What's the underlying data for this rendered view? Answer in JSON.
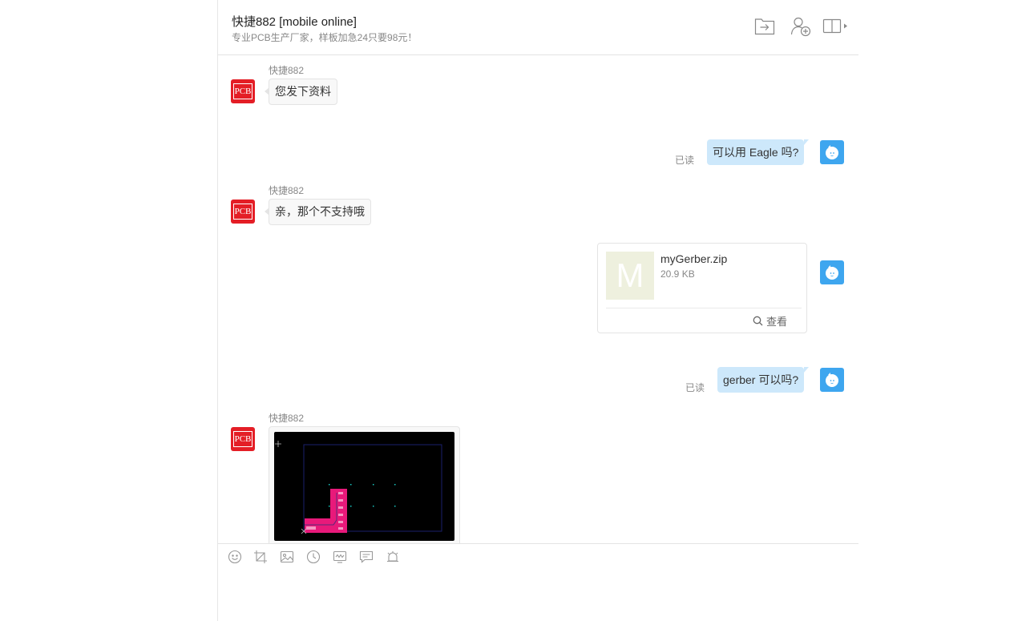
{
  "header": {
    "title": "快捷882 [mobile online]",
    "subtitle": "专业PCB生产厂家，样板加急24只要98元！",
    "icons": [
      "send-file-icon",
      "add-user-icon",
      "sidebar-toggle-icon"
    ]
  },
  "contact": {
    "name": "快捷882",
    "avatar_text": "PCB"
  },
  "messages": [
    {
      "sender": "快捷882",
      "direction": "in",
      "text": "您发下资料"
    },
    {
      "direction": "out",
      "text": "可以用 Eagle 吗?",
      "status": "已读"
    },
    {
      "sender": "快捷882",
      "direction": "in",
      "text": "亲，那个不支持哦"
    },
    {
      "direction": "out",
      "type": "file",
      "thumb_letter": "M",
      "file_name": "myGerber.zip",
      "file_size": "20.9 KB",
      "action": "查看"
    },
    {
      "direction": "out",
      "text": "gerber 可以吗?",
      "status": "已读"
    },
    {
      "sender": "快捷882",
      "direction": "in",
      "type": "image",
      "image_desc": "pcb-gerber-preview"
    }
  ],
  "toolbar": {
    "icons": [
      "emoji-icon",
      "screenshot-crop-icon",
      "image-icon",
      "history-clock-icon",
      "signature-icon",
      "quick-reply-icon",
      "bell-icon"
    ]
  },
  "colors": {
    "accent_blue": "#3ea6ef",
    "out_bubble": "#cde8fb",
    "in_bubble": "#f8f8f8",
    "pcb_red": "#e41e26",
    "pcb_magenta": "#e8197a"
  }
}
